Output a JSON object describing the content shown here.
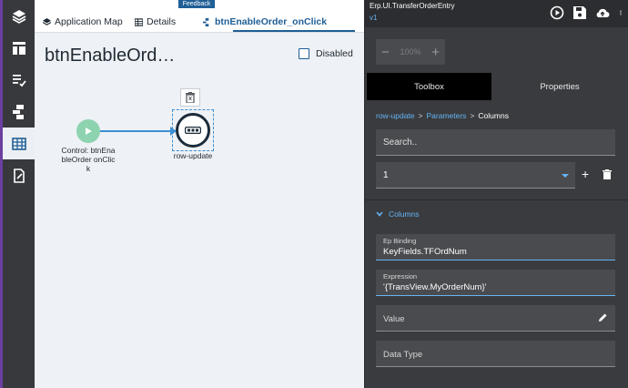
{
  "tabs": {
    "feedback": "Feedback",
    "items": [
      {
        "label": "Application Map",
        "icon": "layers-icon"
      },
      {
        "label": "Details",
        "icon": "table-icon"
      },
      {
        "label": "btnEnableOrder_onClick",
        "icon": "workflow-icon",
        "active": true
      }
    ]
  },
  "canvas": {
    "title": "btnEnableOrd…",
    "disabled_label": "Disabled",
    "disabled_checked": false,
    "start_node_label": "Control: btnEnableOrder onClick",
    "step_node_label": "row-update"
  },
  "panel": {
    "title": "Erp.UI.TransferOrderEntry",
    "version": "v1",
    "zoom": "100%",
    "tabs": [
      "Toolbox",
      "Properties"
    ],
    "breadcrumb": [
      "row-update",
      "Parameters",
      "Columns"
    ],
    "search_placeholder": "Search..",
    "select_value": "1",
    "section_label": "Columns",
    "fields": [
      {
        "label": "Ep Binding",
        "value": "KeyFields.TFOrdNum"
      },
      {
        "label": "Expression",
        "value": "'{TransView.MyOrderNum}'"
      },
      {
        "label": "Value",
        "value": ""
      },
      {
        "label": "Data Type",
        "value": ""
      }
    ]
  },
  "colors": {
    "accent": "#1f5f96",
    "link": "#64b5f6",
    "panel_bg": "#3a3b3e",
    "start_node": "#8dd3b0"
  }
}
